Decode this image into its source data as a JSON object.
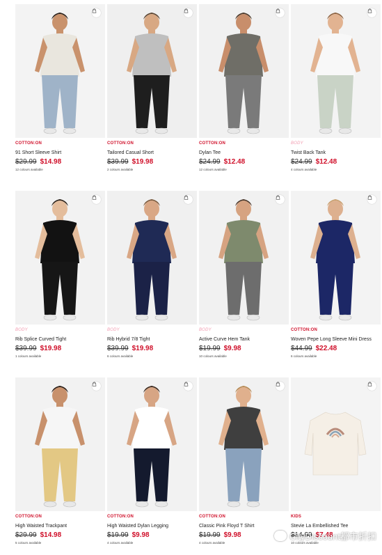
{
  "products": [
    {
      "brand": "COTTON:ON",
      "brand_style": "red",
      "name": "91 Short Sleeve Shirt",
      "old_price": "$29.99",
      "new_price": "$14.98",
      "colours": "12 colours available",
      "bg": "#f3f3f3",
      "top": "#e9e6de",
      "bottom": "#9fb3c8",
      "skin": "#c9926c",
      "hair": "#2a211b"
    },
    {
      "brand": "COTTON:ON",
      "brand_style": "red",
      "name": "Tailored Casual Short",
      "old_price": "$39.99",
      "new_price": "$19.98",
      "colours": "2 colours available",
      "bg": "#efefef",
      "top": "#bfbfbf",
      "bottom": "#1e1e1e",
      "skin": "#d8a883",
      "hair": "#5a4634"
    },
    {
      "brand": "COTTON:ON",
      "brand_style": "red",
      "name": "Dylan Tee",
      "old_price": "$24.99",
      "new_price": "$12.48",
      "colours": "12 colours available",
      "bg": "#f1f1f1",
      "top": "#6f6e67",
      "bottom": "#7a7a7a",
      "skin": "#c88e6b",
      "hair": "#4a3a2c"
    },
    {
      "brand": "BODY",
      "brand_style": "pink",
      "name": "Twist Back Tank",
      "old_price": "$24.99",
      "new_price": "$12.48",
      "colours": "4 colours available",
      "bg": "#f3f3f3",
      "top": "#f8f8f8",
      "bottom": "#c9d3c6",
      "skin": "#e2b391",
      "hair": "#8d6443"
    },
    {
      "brand": "BODY",
      "brand_style": "pink",
      "name": "Rib Splice Curved Tight",
      "old_price": "$39.99",
      "new_price": "$19.98",
      "colours": "1 colours available",
      "bg": "#f2f2f2",
      "top": "#121212",
      "bottom": "#161616",
      "skin": "#e4bd9c",
      "hair": "#2b2119"
    },
    {
      "brand": "BODY",
      "brand_style": "pink",
      "name": "Rib Hybrid 7/8 Tight",
      "old_price": "$39.99",
      "new_price": "$19.98",
      "colours": "6 colours available",
      "bg": "#f0f0f0",
      "top": "#1f2a55",
      "bottom": "#1b2247",
      "skin": "#d9a785",
      "hair": "#7b5a3d"
    },
    {
      "brand": "BODY",
      "brand_style": "pink",
      "name": "Active Curve Hem Tank",
      "old_price": "$19.99",
      "new_price": "$9.98",
      "colours": "10 colours available",
      "bg": "#f1f1f1",
      "top": "#7e8a6d",
      "bottom": "#6d6d6d",
      "skin": "#d6a381",
      "hair": "#4a372a"
    },
    {
      "brand": "COTTON:ON",
      "brand_style": "red",
      "name": "Woven Pepe Long Sleeve Mini Dress",
      "old_price": "$44.99",
      "new_price": "$22.48",
      "colours": "6 colours available",
      "bg": "#f3f3f3",
      "top": "#1c2766",
      "bottom": "#1c2766",
      "skin": "#ddb08f",
      "hair": "#c9a070"
    },
    {
      "brand": "COTTON:ON",
      "brand_style": "red",
      "name": "High Waisted Trackpant",
      "old_price": "$29.99",
      "new_price": "$14.98",
      "colours": "5 colours available",
      "bg": "#f2f2f2",
      "top": "#f6f6f6",
      "bottom": "#e3c884",
      "skin": "#c8916c",
      "hair": "#2a1d16"
    },
    {
      "brand": "COTTON:ON",
      "brand_style": "red",
      "name": "High Waisted Dylan Legging",
      "old_price": "$19.99",
      "new_price": "$9.98",
      "colours": "4 colours available",
      "bg": "#f2f2f2",
      "top": "#ffffff",
      "bottom": "#141a2e",
      "skin": "#d7a584",
      "hair": "#3b2a1f"
    },
    {
      "brand": "COTTON:ON",
      "brand_style": "red",
      "name": "Classic Pink Floyd T Shirt",
      "old_price": "$19.99",
      "new_price": "$9.98",
      "colours": "4 colours available",
      "bg": "#f1f1f1",
      "top": "#3f3f3f",
      "bottom": "#8aa2bd",
      "skin": "#e0b08d",
      "hair": "#b58a55"
    },
    {
      "brand": "KIDS",
      "brand_style": "kids",
      "name": "Stevie La Embellished Tee",
      "old_price": "$14.99",
      "new_price": "$7.48",
      "colours": "10 colours available",
      "bg": "#f4f4f4",
      "top": "#f5efe6",
      "bottom": "#f5efe6",
      "skin": "#f4f4f4",
      "hair": "#f4f4f4"
    }
  ],
  "icons": {
    "bag": "shopping-bag-icon"
  },
  "watermark": {
    "text": "CityDiscount都市折扣"
  }
}
